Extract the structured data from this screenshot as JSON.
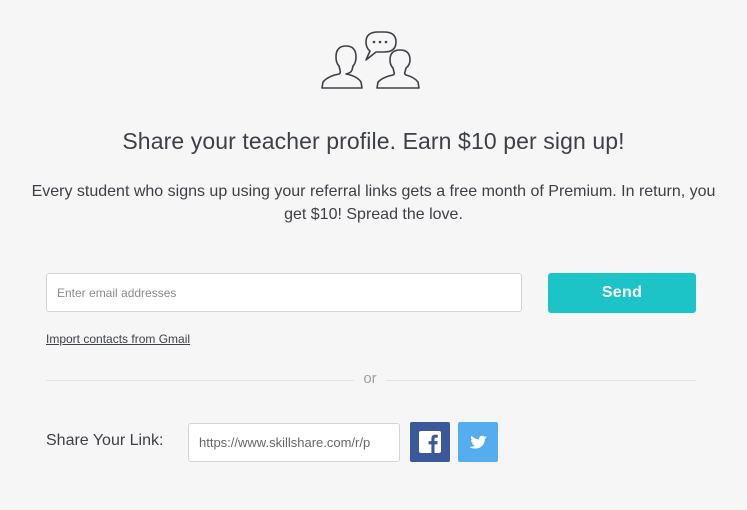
{
  "hero": {
    "icon": "people-chat-icon"
  },
  "headline": "Share your teacher profile. Earn $10 per sign up!",
  "subtext": "Every student who signs up using your referral links gets a free month of Premium. In return, you get $10! Spread the love.",
  "email_form": {
    "placeholder": "Enter email addresses",
    "value": "",
    "send_label": "Send",
    "import_link": "Import contacts from Gmail"
  },
  "divider_text": "or",
  "share_link": {
    "label": "Share Your Link:",
    "url": "https://www.skillshare.com/r/p",
    "facebook_icon": "facebook-icon",
    "twitter_icon": "twitter-icon"
  },
  "colors": {
    "accent": "#1cc4c8",
    "facebook": "#3b5998",
    "twitter": "#55acee",
    "text": "#3d4047"
  }
}
